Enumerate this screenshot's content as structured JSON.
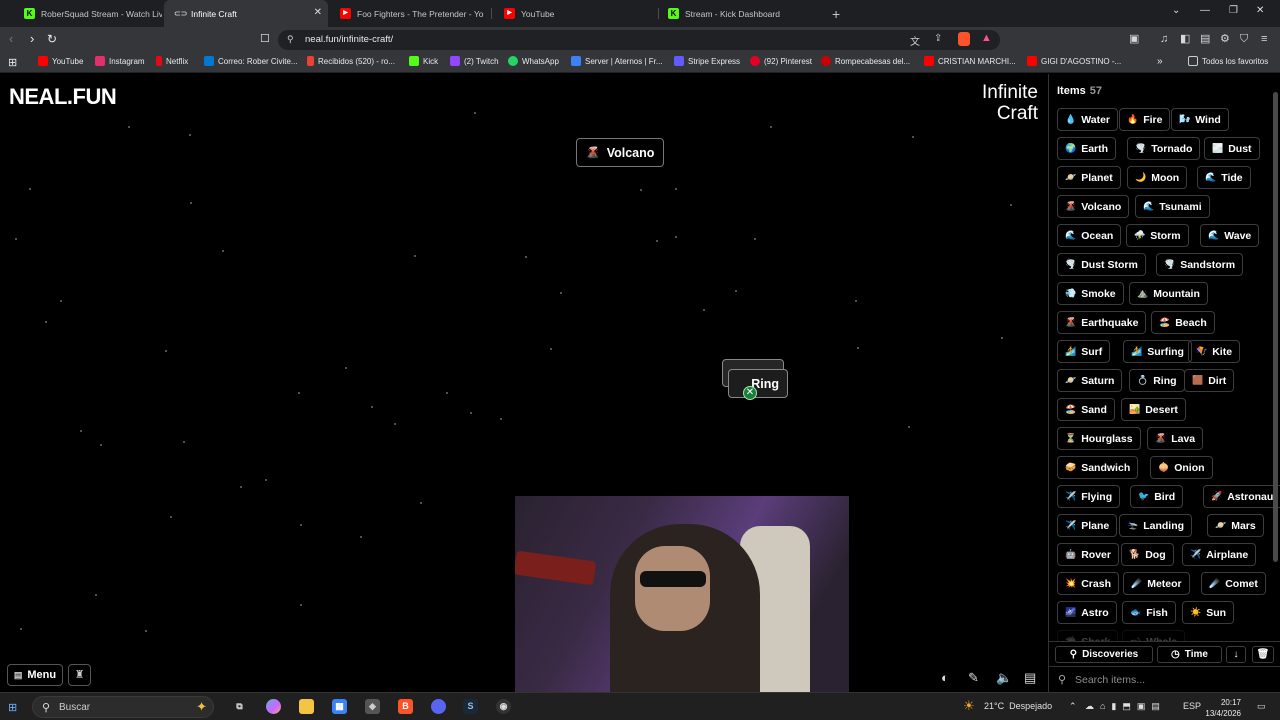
{
  "browser": {
    "tabs": [
      {
        "title": "RoberSquad Stream - Watch Live",
        "icon": "kick-icon",
        "color": "#53fc18"
      },
      {
        "title": "Infinite Craft",
        "icon": "link-icon",
        "color": "#888888",
        "active": true
      },
      {
        "title": "Foo Fighters - The Pretender - Yo",
        "icon": "youtube-icon",
        "color": "#ff0000"
      },
      {
        "title": "YouTube",
        "icon": "youtube-icon",
        "color": "#ff0000"
      },
      {
        "title": "Stream - Kick Dashboard",
        "icon": "kick-icon",
        "color": "#53fc18"
      }
    ],
    "new_tab": "+",
    "url": "neal.fun/infinite-craft/",
    "bookmarks": [
      {
        "label": "YouTube",
        "color": "#ff0000"
      },
      {
        "label": "Instagram",
        "color": "#e1306c"
      },
      {
        "label": "Netflix",
        "color": "#e50914"
      },
      {
        "label": "Correo: Rober Civite...",
        "color": "#0078d4"
      },
      {
        "label": "Recibidos (520) - ro...",
        "color": "#ea4335"
      },
      {
        "label": "Kick",
        "color": "#53fc18"
      },
      {
        "label": "(2) Twitch",
        "color": "#9146ff"
      },
      {
        "label": "WhatsApp",
        "color": "#25d366"
      },
      {
        "label": "Server | Aternos | Fr...",
        "color": "#3b82f6"
      },
      {
        "label": "Stripe Express",
        "color": "#635bff"
      },
      {
        "label": "(92) Pinterest",
        "color": "#e60023"
      },
      {
        "label": "Rompecabesas del...",
        "color": "#cc0000"
      },
      {
        "label": "CRISTIAN MARCHI...",
        "color": "#ff0000"
      },
      {
        "label": "GIGI D'AGOSTINO -...",
        "color": "#ff0000"
      }
    ],
    "bookmarks_more": "»",
    "all_favorites": "Todos los favoritos"
  },
  "game": {
    "logo": "NEAL.FUN",
    "title_line1": "Infinite",
    "title_line2": "Craft",
    "canvas_elements": [
      {
        "emoji": "🌋",
        "label": "Volcano"
      }
    ],
    "dragging": {
      "label": "Ring"
    },
    "menu_label": "Menu"
  },
  "sidebar": {
    "title": "Items",
    "count": "57",
    "items": [
      {
        "emoji": "💧",
        "label": "Water"
      },
      {
        "emoji": "🔥",
        "label": "Fire"
      },
      {
        "emoji": "🌬️",
        "label": "Wind"
      },
      {
        "emoji": "🌍",
        "label": "Earth"
      },
      {
        "emoji": "🌪️",
        "label": "Tornado"
      },
      {
        "emoji": "🌫️",
        "label": "Dust"
      },
      {
        "emoji": "🪐",
        "label": "Planet"
      },
      {
        "emoji": "🌙",
        "label": "Moon"
      },
      {
        "emoji": "🌊",
        "label": "Tide"
      },
      {
        "emoji": "🌋",
        "label": "Volcano"
      },
      {
        "emoji": "🌊",
        "label": "Tsunami"
      },
      {
        "emoji": "🌊",
        "label": "Ocean"
      },
      {
        "emoji": "⛈️",
        "label": "Storm"
      },
      {
        "emoji": "🌊",
        "label": "Wave"
      },
      {
        "emoji": "🌪️",
        "label": "Dust Storm"
      },
      {
        "emoji": "🌪️",
        "label": "Sandstorm"
      },
      {
        "emoji": "💨",
        "label": "Smoke"
      },
      {
        "emoji": "⛰️",
        "label": "Mountain"
      },
      {
        "emoji": "🌋",
        "label": "Earthquake"
      },
      {
        "emoji": "🏖️",
        "label": "Beach"
      },
      {
        "emoji": "🏄",
        "label": "Surf"
      },
      {
        "emoji": "🏄",
        "label": "Surfing"
      },
      {
        "emoji": "🪁",
        "label": "Kite"
      },
      {
        "emoji": "🪐",
        "label": "Saturn"
      },
      {
        "emoji": "💍",
        "label": "Ring"
      },
      {
        "emoji": "🟫",
        "label": "Dirt"
      },
      {
        "emoji": "🏖️",
        "label": "Sand"
      },
      {
        "emoji": "🏜️",
        "label": "Desert"
      },
      {
        "emoji": "⏳",
        "label": "Hourglass"
      },
      {
        "emoji": "🌋",
        "label": "Lava"
      },
      {
        "emoji": "🥪",
        "label": "Sandwich"
      },
      {
        "emoji": "🧅",
        "label": "Onion"
      },
      {
        "emoji": "✈️",
        "label": "Flying"
      },
      {
        "emoji": "🐦",
        "label": "Bird"
      },
      {
        "emoji": "🚀",
        "label": "Astronaut"
      },
      {
        "emoji": "✈️",
        "label": "Plane"
      },
      {
        "emoji": "🛬",
        "label": "Landing"
      },
      {
        "emoji": "🪐",
        "label": "Mars"
      },
      {
        "emoji": "🤖",
        "label": "Rover"
      },
      {
        "emoji": "🐕",
        "label": "Dog"
      },
      {
        "emoji": "✈️",
        "label": "Airplane"
      },
      {
        "emoji": "💥",
        "label": "Crash"
      },
      {
        "emoji": "☄️",
        "label": "Meteor"
      },
      {
        "emoji": "☄️",
        "label": "Comet"
      },
      {
        "emoji": "🌌",
        "label": "Astro"
      },
      {
        "emoji": "🐟",
        "label": "Fish"
      },
      {
        "emoji": "☀️",
        "label": "Sun"
      },
      {
        "emoji": "🦈",
        "label": "Shark"
      },
      {
        "emoji": "🐋",
        "label": "Whale"
      }
    ],
    "discoveries_label": "Discoveries",
    "time_label": "Time",
    "search_placeholder": "Search items..."
  },
  "taskbar": {
    "search_label": "Buscar",
    "weather_temp": "21°C",
    "weather_desc": "Despejado",
    "language": "ESP",
    "time": "20:17",
    "date": "13/4/2026"
  }
}
